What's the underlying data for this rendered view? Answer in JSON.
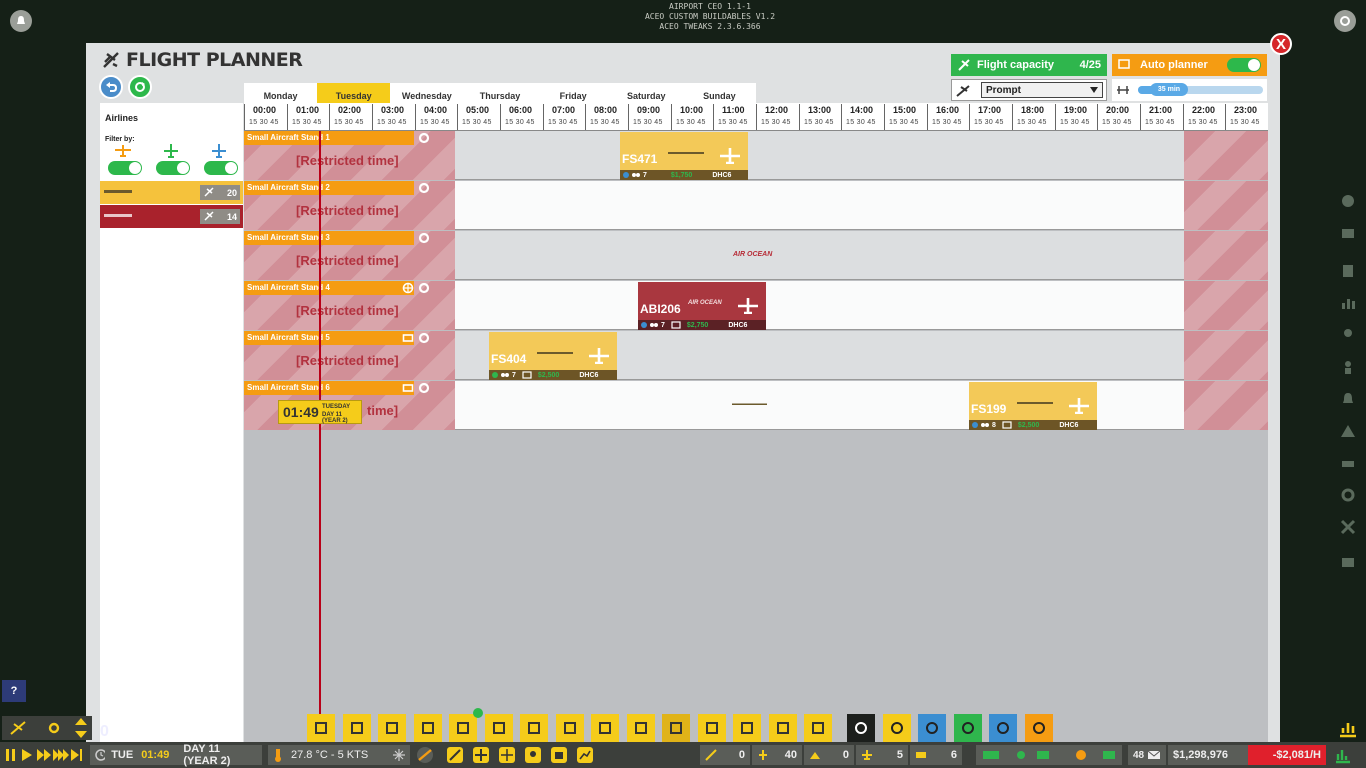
{
  "version": [
    "AIRPORT CEO 1.1-1",
    "ACEO CUSTOM BUILDABLES V1.2",
    "ACEO TWEAKS 2.3.6.366"
  ],
  "planner": {
    "title": "FLIGHT PLANNER",
    "close": "X",
    "days": [
      "Monday",
      "Tuesday",
      "Wednesday",
      "Thursday",
      "Friday",
      "Saturday",
      "Sunday"
    ],
    "active_day": "Tuesday",
    "hours": [
      "00:00",
      "01:00",
      "02:00",
      "03:00",
      "04:00",
      "05:00",
      "06:00",
      "07:00",
      "08:00",
      "09:00",
      "10:00",
      "11:00",
      "12:00",
      "13:00",
      "14:00",
      "15:00",
      "16:00",
      "17:00",
      "18:00",
      "19:00",
      "20:00",
      "21:00",
      "22:00",
      "23:00"
    ],
    "minutes": "15 30 45",
    "flight_capacity": {
      "label": "Flight capacity",
      "value": "4/25"
    },
    "auto_planner": {
      "label": "Auto planner"
    },
    "mode": {
      "value": "Prompt"
    },
    "slider": {
      "value": "35 min"
    }
  },
  "sidebar": {
    "title": "Airlines",
    "filter_label": "Filter by:",
    "airlines": [
      {
        "count": "20",
        "color": "#f5c23c"
      },
      {
        "count": "14",
        "color": "#a9222c"
      }
    ]
  },
  "stands": [
    {
      "label": "Small Aircraft Stand 1",
      "restricted": "[Restricted time]"
    },
    {
      "label": "Small Aircraft Stand 2",
      "restricted": "[Restricted time]"
    },
    {
      "label": "Small Aircraft Stand 3",
      "restricted": "[Restricted time]"
    },
    {
      "label": "Small Aircraft Stand 4",
      "restricted": "[Restricted time]"
    },
    {
      "label": "Small Aircraft Stand 5",
      "restricted": "[Restricted time]"
    },
    {
      "label": "Small Aircraft Stand 6",
      "restricted": "time]"
    }
  ],
  "flights": [
    {
      "code": "FS471",
      "pax": "7",
      "price": "$1,750",
      "aircraft": "DHC6",
      "color": "#f3c958"
    },
    {
      "code": "ABI206",
      "pax": "7",
      "price": "$2,750",
      "aircraft": "DHC6",
      "color": "#a9373f"
    },
    {
      "code": "FS404",
      "pax": "7",
      "price": "$2,500",
      "aircraft": "DHC6",
      "color": "#f3c958"
    },
    {
      "code": "FS199",
      "pax": "8",
      "price": "$2,500",
      "aircraft": "DHC6",
      "color": "#f3c958"
    }
  ],
  "logos": {
    "air_ocean": "AIR OCEAN"
  },
  "clock": {
    "time": "01:49",
    "day": "TUESDAY",
    "date": "DAY 11 (YEAR 2)"
  },
  "help": "?",
  "queue_count": "0",
  "status": {
    "weekday": "TUE",
    "time": "01:49",
    "day": "DAY 11 (YEAR 2)",
    "weather": "27.8 °C - 5 KTS",
    "counters": [
      "0",
      "40",
      "0",
      "5",
      "6"
    ],
    "mail": "48",
    "money": "$1,298,976",
    "rate": "-$2,081/H"
  },
  "colors": {
    "accent": "#f5cc1a",
    "stand": "#f59c12",
    "restricted": "#d18f97",
    "capacity": "#2fb64d",
    "autoplanner": "#f59c12"
  }
}
